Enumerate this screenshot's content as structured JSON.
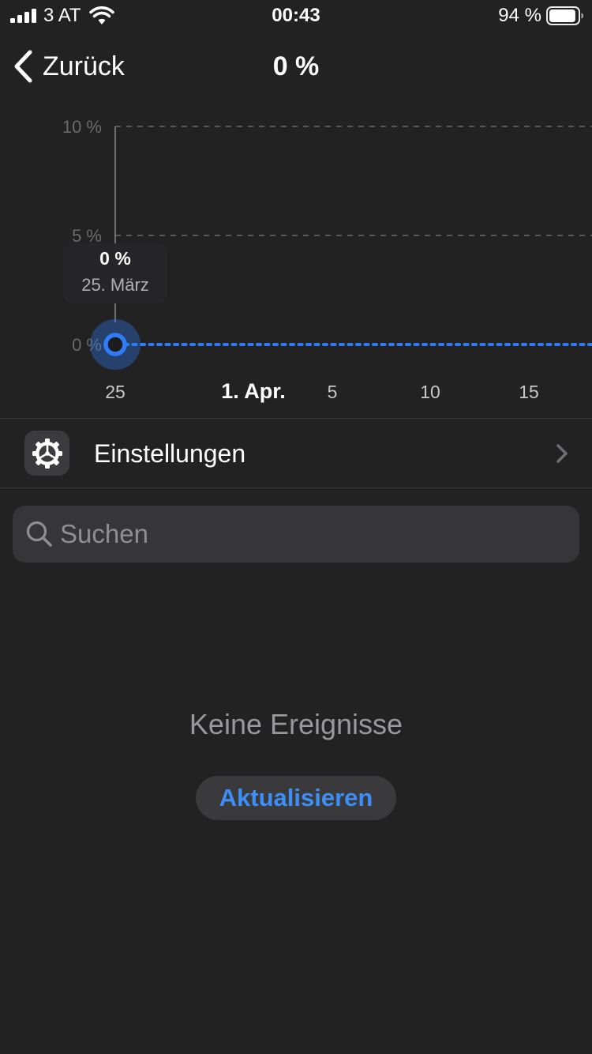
{
  "status_bar": {
    "carrier": "3 AT",
    "time": "00:43",
    "battery": "94 %",
    "battery_level": 0.94
  },
  "nav": {
    "back_label": "Zurück",
    "title": "0 %"
  },
  "chart_data": {
    "type": "line",
    "x": [
      "25. März"
    ],
    "x_ticks": [
      "25",
      "1. Apr.",
      "5",
      "10",
      "15"
    ],
    "y_ticks": [
      "10 %",
      "5 %",
      "0 %"
    ],
    "series": [
      {
        "values": [
          0
        ],
        "color": "#2f7cf6"
      }
    ],
    "ylim": [
      0,
      10
    ],
    "y_unit": "%",
    "grid": "dashed horizontal",
    "tooltip": {
      "value": "0 %",
      "date": "25. März"
    }
  },
  "settings": {
    "label": "Einstellungen"
  },
  "search": {
    "placeholder": "Suchen",
    "value": ""
  },
  "empty_state": {
    "message": "Keine Ereignisse",
    "button_label": "Aktualisieren"
  },
  "colors": {
    "background": "#222222",
    "accent": "#3d8ef5",
    "chart_line": "#2f7cf6"
  }
}
